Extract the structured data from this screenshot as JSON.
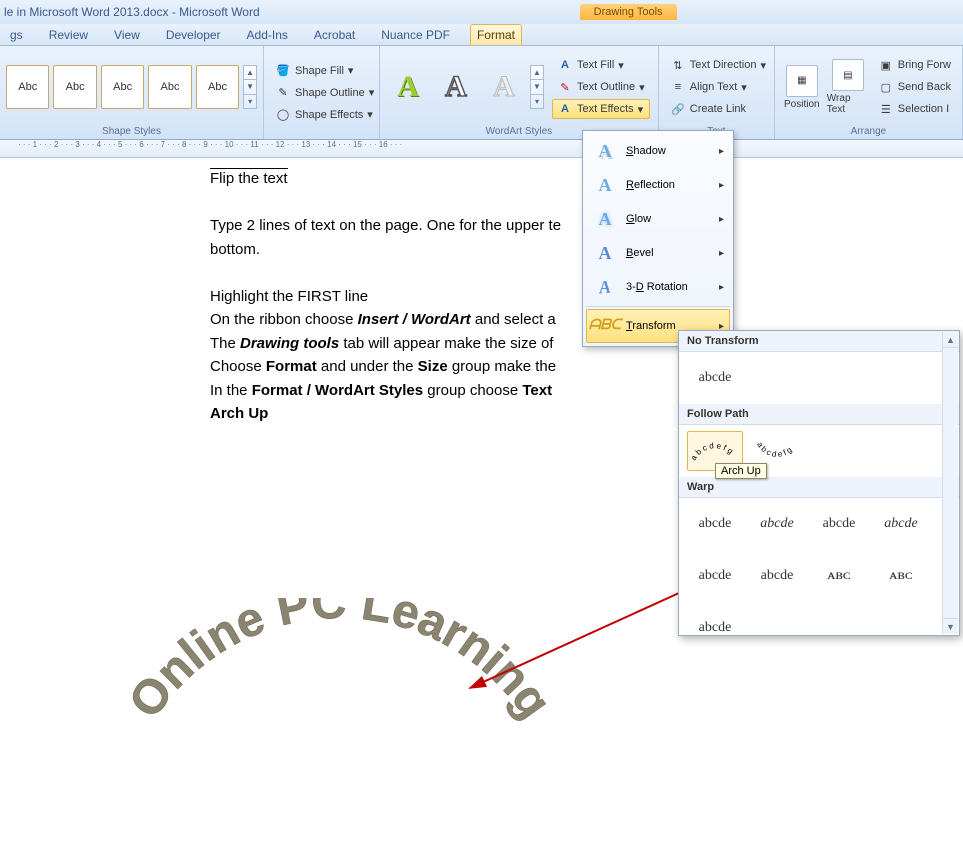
{
  "window": {
    "title_fragment": "le in Microsoft Word 2013.docx - Microsoft Word",
    "contextual_tab_group": "Drawing Tools"
  },
  "tabs": {
    "partial0": "gs",
    "review": "Review",
    "view": "View",
    "developer": "Developer",
    "addins": "Add-Ins",
    "acrobat": "Acrobat",
    "nuance": "Nuance PDF",
    "format": "Format"
  },
  "ribbon": {
    "shape_styles": {
      "label": "Shape Styles",
      "sample": "Abc",
      "fill": "Shape Fill",
      "outline": "Shape Outline",
      "effects": "Shape Effects"
    },
    "wordart_styles": {
      "label": "WordArt Styles",
      "text_fill": "Text Fill",
      "text_outline": "Text Outline",
      "text_effects": "Text Effects"
    },
    "text": {
      "label": "Text",
      "direction": "Text Direction",
      "align": "Align Text",
      "link": "Create Link"
    },
    "arrange": {
      "label": "Arrange",
      "position": "Position",
      "wrap": "Wrap Text",
      "bring": "Bring Forw",
      "send": "Send Back",
      "selection": "Selection I"
    }
  },
  "ruler_text": "· · · 1 · · · 2 · · · 3 · · · 4 · · · 5 · · · 6 · · · 7 · · · 8 · · · 9 · · · 10 · · · 11 · · · 12 · · · 13 · · · 14 · · · 15 · · · 16 · · ·",
  "document": {
    "line0": "Flip the text",
    "line1a": "Type 2 lines of text on the page. One for the upper te",
    "line1b": "bottom.",
    "line2": "Highlight the FIRST line",
    "line3a": "On the ribbon choose ",
    "line3b": "Insert / WordArt",
    "line3c": " and select a ",
    "line4a": "The ",
    "line4b": "Drawing tools",
    "line4c": " tab will appear make the size of ",
    "line5a": "Choose ",
    "line5b": "Format",
    "line5c": " and under the ",
    "line5d": "Size",
    "line5e": " group make the ",
    "line6a": "In the ",
    "line6b": "Format / WordArt Styles",
    "line6c": " group choose ",
    "line6d": "Text ",
    "line7": "Arch Up",
    "arched_text": "Online PC Learning"
  },
  "fx_menu": {
    "shadow": "Shadow",
    "reflection": "Reflection",
    "glow": "Glow",
    "bevel": "Bevel",
    "rotation": "3-D Rotation",
    "transform": "Transform"
  },
  "transform_panel": {
    "no_transform": "No Transform",
    "sample_plain": "abcde",
    "follow_path": "Follow Path",
    "tooltip": "Arch Up",
    "warp": "Warp",
    "warp_sample": "abcde"
  }
}
